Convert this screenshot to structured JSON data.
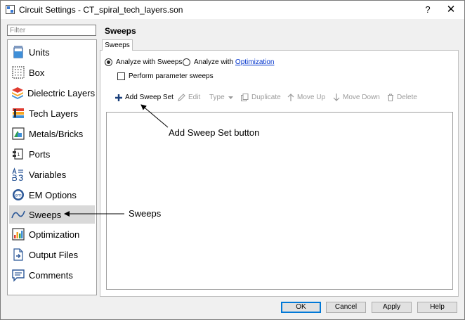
{
  "window": {
    "title": "Circuit Settings - CT_spiral_tech_layers.son",
    "help_glyph": "?",
    "close_glyph": "✕"
  },
  "filter": {
    "placeholder": "Filter",
    "value": ""
  },
  "nav": {
    "items": [
      {
        "label": "Units",
        "icon": "units-icon"
      },
      {
        "label": "Box",
        "icon": "box-icon"
      },
      {
        "label": "Dielectric Layers",
        "icon": "dielectric-layers-icon"
      },
      {
        "label": "Tech Layers",
        "icon": "tech-layers-icon"
      },
      {
        "label": "Metals/Bricks",
        "icon": "metals-bricks-icon"
      },
      {
        "label": "Ports",
        "icon": "ports-icon"
      },
      {
        "label": "Variables",
        "icon": "variables-icon"
      },
      {
        "label": "EM Options",
        "icon": "em-options-icon"
      },
      {
        "label": "Sweeps",
        "icon": "sweeps-icon",
        "selected": true
      },
      {
        "label": "Optimization",
        "icon": "optimization-icon"
      },
      {
        "label": "Output Files",
        "icon": "output-files-icon"
      },
      {
        "label": "Comments",
        "icon": "comments-icon"
      }
    ]
  },
  "page": {
    "title": "Sweeps",
    "tab_label": "Sweeps",
    "radio_sweeps": "Analyze with Sweeps",
    "radio_opt_prefix": "Analyze with ",
    "radio_opt_link": "Optimization",
    "radio_selected": "sweeps",
    "checkbox_label": "Perform parameter sweeps",
    "checkbox_checked": false
  },
  "toolbar": {
    "add_sweep_set": "Add Sweep Set",
    "edit": "Edit",
    "type": "Type",
    "duplicate": "Duplicate",
    "move_up": "Move Up",
    "move_down": "Move Down",
    "delete": "Delete"
  },
  "annotations": {
    "add_sweep_set": "Add Sweep Set button",
    "sweeps": "Sweeps"
  },
  "buttons": {
    "ok": "OK",
    "cancel": "Cancel",
    "apply": "Apply",
    "help": "Help"
  },
  "colors": {
    "accent": "#0078d7",
    "link": "#0033cc",
    "selected_bg": "#d9d9d9"
  }
}
